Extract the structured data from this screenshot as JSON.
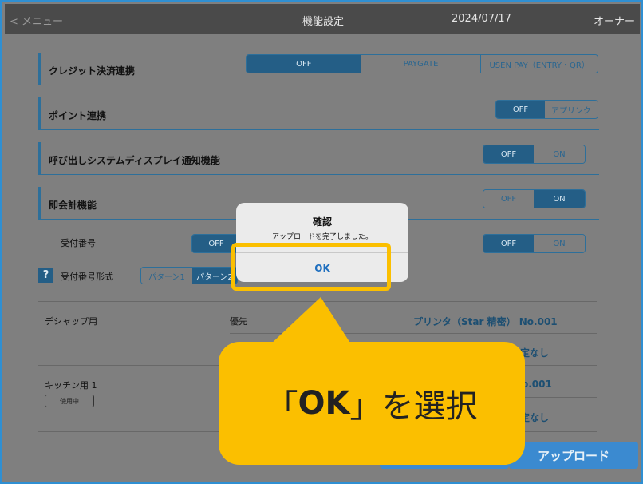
{
  "topbar": {
    "back": "< メニュー",
    "title": "機能設定",
    "date": "2024/07/17",
    "user": "オーナー"
  },
  "settings": {
    "credit": {
      "label": "クレジット決済連携",
      "options": [
        "OFF",
        "PAYGATE",
        "USEN PAY（ENTRY・QR）"
      ],
      "selected": "OFF"
    },
    "point": {
      "label": "ポイント連携",
      "options": [
        "OFF",
        "アプリンク"
      ],
      "selected": "OFF"
    },
    "call_display": {
      "label": "呼び出しシステムディスプレイ通知機能",
      "options": [
        "OFF",
        "ON"
      ],
      "selected": "OFF"
    },
    "instant_pay": {
      "label": "即会計機能",
      "options": [
        "OFF",
        "ON"
      ],
      "selected": "ON"
    },
    "reception_no": {
      "label": "受付番号",
      "left_option": "OFF",
      "right_options": [
        "OFF",
        "ON"
      ],
      "right_selected": "OFF"
    },
    "reception_format": {
      "help": "?",
      "label": "受付番号形式",
      "options": [
        "パターン1",
        "パターン2"
      ],
      "selected": "パターン2"
    }
  },
  "printers": {
    "deshap_label": "デシャップ用",
    "priority_label": "優先",
    "deshap_printer": "プリンタ（Star 精密） No.001",
    "deshap_second": "定なし",
    "kitchen_label": "キッチン用 1",
    "kitchen_badge": "使用中",
    "kitchen_printer": "o.001",
    "kitchen_second": "定なし"
  },
  "buttons": {
    "upload": "アップロード"
  },
  "dialog": {
    "title": "確認",
    "message": "アップロードを完了しました。",
    "ok": "OK"
  },
  "callout": {
    "open": "「",
    "ok": "OK",
    "close": "」",
    "rest": "を選択"
  },
  "colors": {
    "accent": "#2f8fd2",
    "callout": "#fbbf00",
    "selected": "#245e86"
  }
}
